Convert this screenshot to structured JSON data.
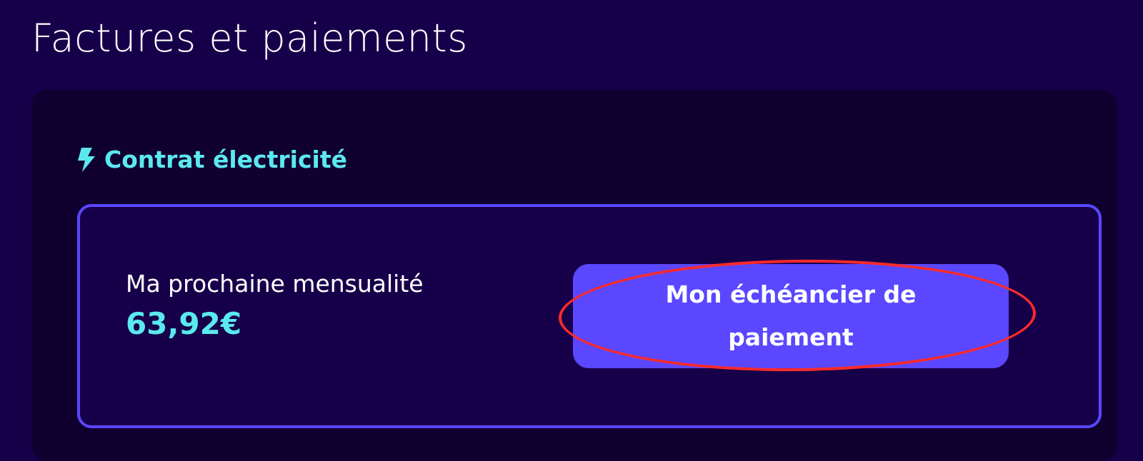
{
  "page": {
    "title": "Factures et paiements"
  },
  "contract": {
    "title": "Contrat électricité",
    "icon": "lightning-bolt-icon",
    "monthly_label": "Ma prochaine mensualité",
    "monthly_amount": "63,92€",
    "schedule_button_label": "Mon échéancier de paiement"
  },
  "colors": {
    "background": "#17004a",
    "card_background": "#10002f",
    "accent": "#5a47ff",
    "highlight_text": "#5be9f0",
    "annotation": "#ff2a2a"
  }
}
